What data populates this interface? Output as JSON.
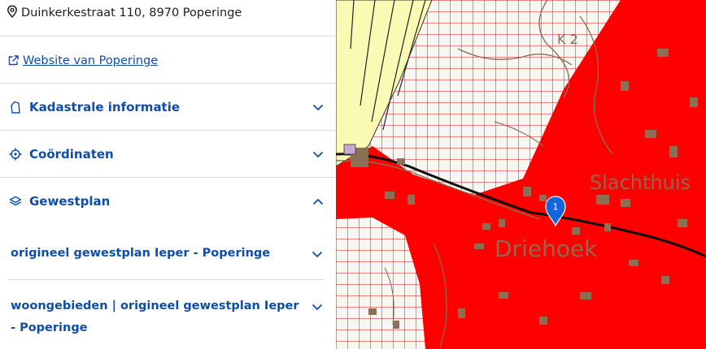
{
  "address": {
    "text": "Duinkerkestraat 110, 8970 Poperinge",
    "icon": "location-pin-icon"
  },
  "website_link": {
    "label": "Website van Poperinge",
    "icon": "external-link-icon"
  },
  "sections": [
    {
      "label": "Kadastrale informatie",
      "icon": "parcel-icon",
      "expanded": false
    },
    {
      "label": "Coördinaten",
      "icon": "crosshair-icon",
      "expanded": false
    },
    {
      "label": "Gewestplan",
      "icon": "layers-icon",
      "expanded": true
    }
  ],
  "gewestplan_items": [
    {
      "label": "origineel gewestplan Ieper - Poperinge"
    },
    {
      "label": "woongebieden | origineel gewestplan Ieper - Poperinge"
    }
  ],
  "map": {
    "labels": {
      "district": "Driehoek",
      "building": "Slachthuis",
      "code": "K 2"
    },
    "marker_number": "1",
    "colors": {
      "zone_red": "#ff0000",
      "grid_red": "#e01010",
      "yellow_zone": "#fafab4",
      "road_brown": "#8b7055",
      "marker_blue": "#1664d9",
      "link_blue": "#0f4da6"
    }
  }
}
